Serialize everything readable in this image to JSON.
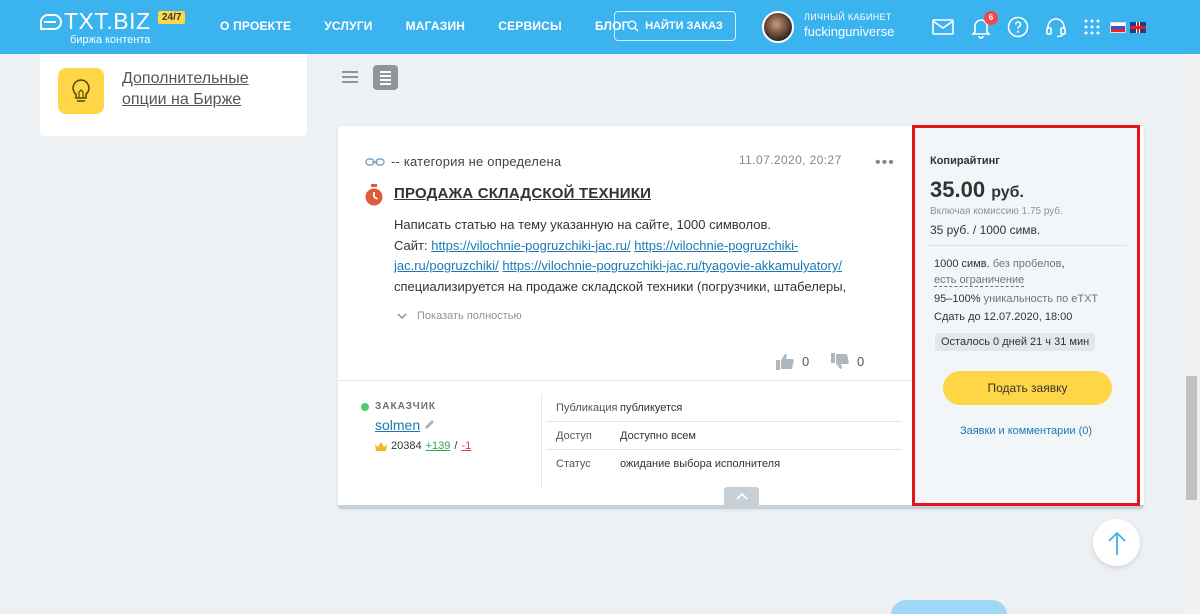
{
  "header": {
    "logo_text": "TXT.BIZ",
    "logo_badge": "24/7",
    "logo_subtitle": "биржа контента",
    "nav": [
      {
        "label": "О ПРОЕКТЕ"
      },
      {
        "label": "УСЛУГИ"
      },
      {
        "label": "МАГАЗИН"
      },
      {
        "label": "СЕРВИСЫ"
      },
      {
        "label": "БЛОГ"
      }
    ],
    "find_order_label": "НАЙТИ ЗАКАЗ",
    "cabinet_label": "ЛИЧНЫЙ КАБИНЕТ",
    "username": "fuckinguniverse",
    "notifications_count": "6",
    "icons": [
      "mail-icon",
      "bell-icon",
      "help-icon",
      "headset-icon",
      "grid-icon",
      "flag-ru-icon",
      "flag-uk-icon"
    ]
  },
  "sidebar": {
    "promo_link": "Дополнительные опции на Бирже"
  },
  "task": {
    "category": "-- категория не определена",
    "date": "11.07.2020, 20:27",
    "title": "ПРОДАЖА СКЛАДСКОЙ ТЕХНИКИ",
    "description_line1": "Написать статью на тему указанную на сайте, 1000 символов.",
    "site_label": "Сайт: ",
    "links": [
      "https://vilochnie-pogruzchiki-jac.ru/",
      "https://vilochnie-pogruzchiki-jac.ru/pogruzchiki/",
      "https://vilochnie-pogruzchiki-jac.ru/tyagovie-akkamulyatory/"
    ],
    "description_tail": "специализируется на продаже складской техники (погрузчики, штабелеры,",
    "show_more": "Показать полностью",
    "likes": "0",
    "dislikes": "0",
    "customer_label": "ЗАКАЗЧИК",
    "customer_name": "solmen",
    "rating_value": "20384",
    "rating_pos": "+139",
    "rating_sep": "/",
    "rating_neg": "-1",
    "info": [
      {
        "key": "Публикация",
        "value": "публикуется"
      },
      {
        "key": "Доступ",
        "value": "Доступно всем"
      },
      {
        "key": "Статус",
        "value": "ожидание выбора исполнителя"
      }
    ]
  },
  "price_panel": {
    "type": "Копирайтинг",
    "price": "35.00",
    "currency": "руб.",
    "commission": "Включая комиссию 1.75 руб.",
    "rate": "35 руб. / 1000 симв.",
    "chars": "1000 симв.",
    "no_spaces": "без пробелов",
    "comma": ",",
    "limit": "есть ограничение",
    "uniq_value": "95–100%",
    "uniq_text": "уникальность по eTXT",
    "deadline": "Сдать до 12.07.2020, 18:00",
    "time_left": "Осталось 0 дней 21 ч 31 мин",
    "apply_label": "Подать заявку",
    "comments_link": "Заявки и комментарии (0)"
  }
}
